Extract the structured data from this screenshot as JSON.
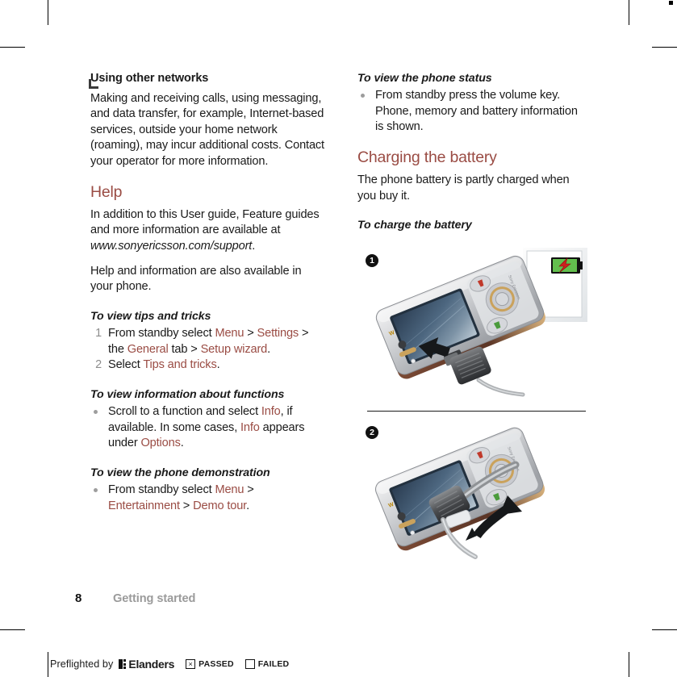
{
  "document": {
    "page_number": "8",
    "section": "Getting started"
  },
  "left_column": {
    "heading_using_other_networks": "Using other networks",
    "para_networks": "Making and receiving calls, using messaging, and data transfer, for example, Internet-based services, outside your home network (roaming), may incur additional costs. Contact your operator for more information.",
    "heading_help": "Help",
    "para_help_1_a": "In addition to this User guide, Feature guides and more information are available at ",
    "para_help_1_url": "www.sonyericsson.com/support",
    "para_help_1_b": ".",
    "para_help_2": "Help and information are also available in your phone.",
    "heading_tips": "To view tips and tricks",
    "steps": [
      {
        "num": "1",
        "parts": [
          {
            "t": "From standby select ",
            "style": "plain"
          },
          {
            "t": "Menu",
            "style": "link"
          },
          {
            "t": " > ",
            "style": "plain"
          },
          {
            "t": "Settings",
            "style": "link"
          },
          {
            "t": " > the ",
            "style": "plain"
          },
          {
            "t": "General",
            "style": "link"
          },
          {
            "t": " tab > ",
            "style": "plain"
          },
          {
            "t": "Setup wizard",
            "style": "link"
          },
          {
            "t": ".",
            "style": "plain"
          }
        ]
      },
      {
        "num": "2",
        "parts": [
          {
            "t": "Select ",
            "style": "plain"
          },
          {
            "t": "Tips and tricks",
            "style": "link"
          },
          {
            "t": ".",
            "style": "plain"
          }
        ]
      }
    ],
    "heading_functions": "To view information about functions",
    "bullet_functions": [
      {
        "t": "Scroll to a function and select ",
        "style": "plain"
      },
      {
        "t": "Info",
        "style": "link"
      },
      {
        "t": ", if available. In some cases, ",
        "style": "plain"
      },
      {
        "t": "Info",
        "style": "link"
      },
      {
        "t": " appears under ",
        "style": "plain"
      },
      {
        "t": "Options",
        "style": "link"
      },
      {
        "t": ".",
        "style": "plain"
      }
    ],
    "heading_demo": "To view the phone demonstration",
    "bullet_demo": [
      {
        "t": "From standby select ",
        "style": "plain"
      },
      {
        "t": "Menu",
        "style": "link"
      },
      {
        "t": " > ",
        "style": "plain"
      },
      {
        "t": "Entertainment",
        "style": "link"
      },
      {
        "t": " > ",
        "style": "plain"
      },
      {
        "t": "Demo tour",
        "style": "link"
      },
      {
        "t": ".",
        "style": "plain"
      }
    ]
  },
  "right_column": {
    "heading_status": "To view the phone status",
    "bullet_status": "From standby press the volume key. Phone, memory and battery information is shown.",
    "heading_charging": "Charging the battery",
    "para_charging": "The phone battery is partly charged when you buy it.",
    "heading_charge": "To charge the battery",
    "figures": [
      {
        "marker": "1",
        "caption_icon": "battery-charging-icon"
      },
      {
        "marker": "2",
        "caption_icon": "charger-rotate-icon"
      }
    ]
  },
  "footer": {
    "preflight_label": "Preflighted by",
    "brand": "Elanders",
    "passed_label": "PASSED",
    "failed_label": "FAILED",
    "passed_mark": "×",
    "failed_mark": ""
  },
  "colors": {
    "accent": "#9a4c44",
    "body_text": "#1a1a1a",
    "muted": "#9b9b9b",
    "battery_green": "#5bb64a",
    "bolt_red": "#d0201f"
  }
}
